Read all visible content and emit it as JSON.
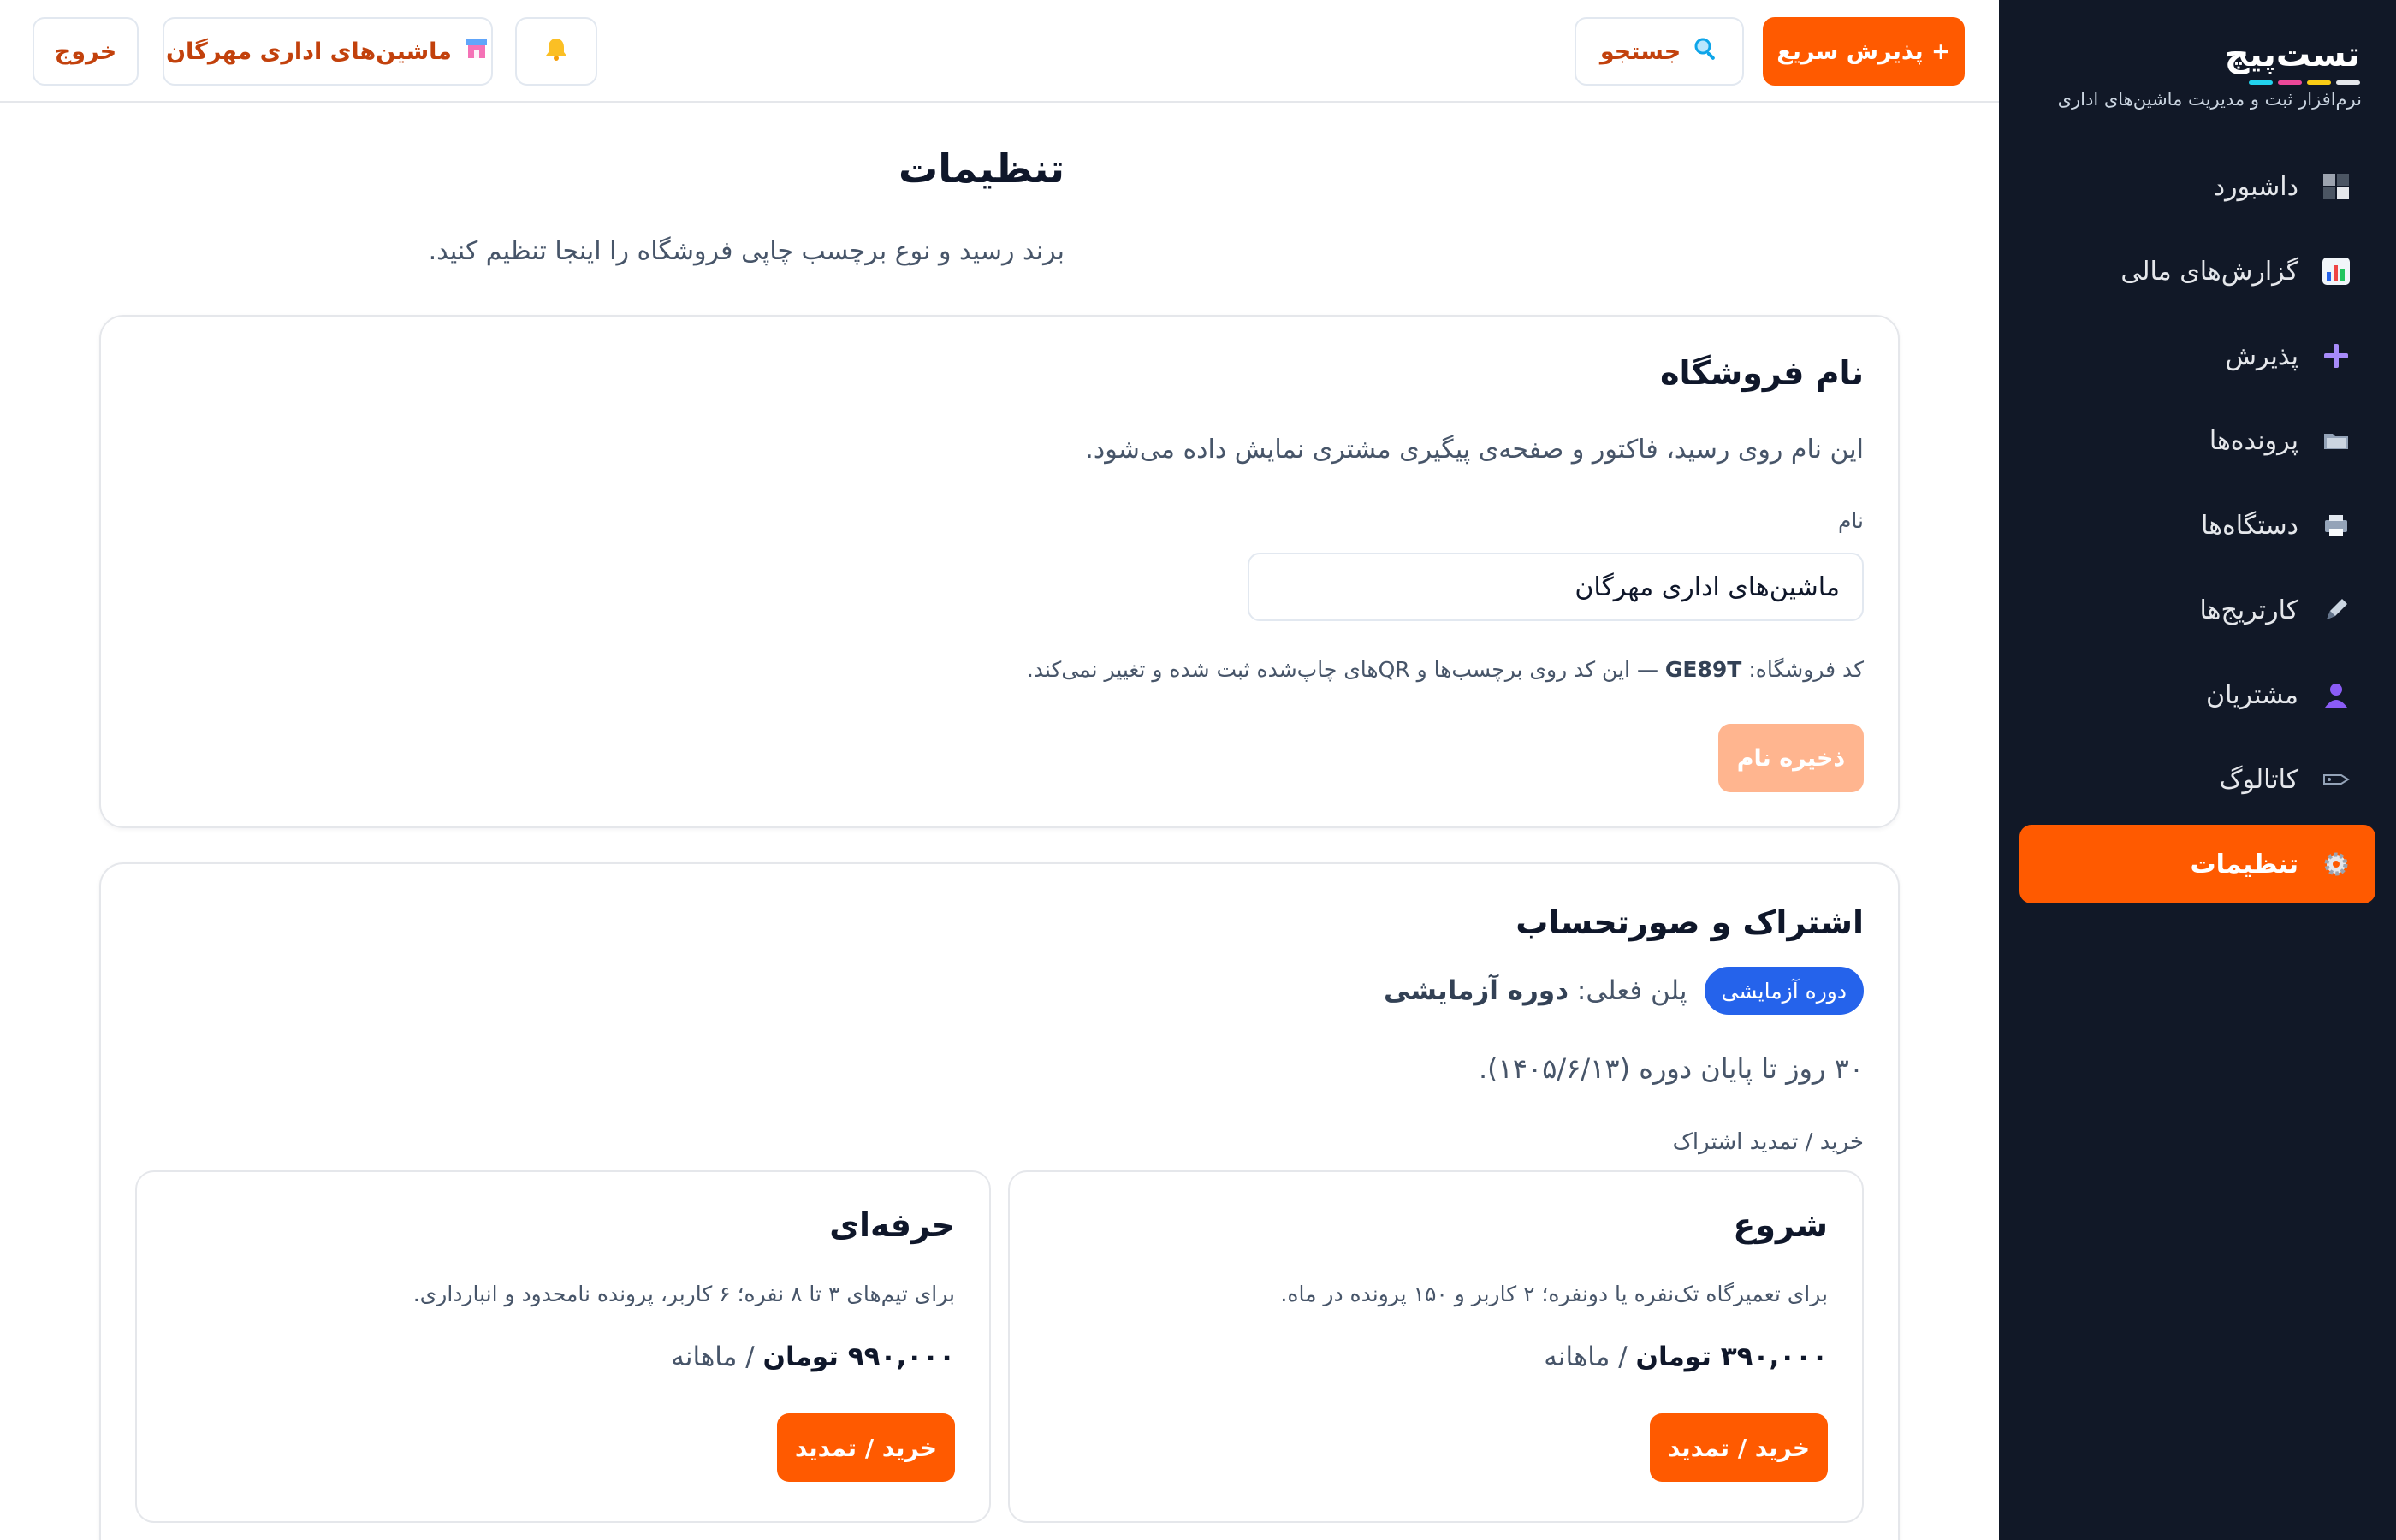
{
  "brand": {
    "name": "تست‌پیچ",
    "tagline": "نرم‌افزار ثبت و مدیریت ماشین‌های اداری",
    "bar_colors": [
      "#22d3ee",
      "#ec4899",
      "#facc15",
      "#e5e7eb"
    ]
  },
  "sidebar": {
    "items": [
      {
        "label": "داشبورد",
        "icon": "dashboard-icon",
        "glyph": "▚"
      },
      {
        "label": "گزارش‌های مالی",
        "icon": "bar-chart-icon",
        "glyph": "📊"
      },
      {
        "label": "پذیرش",
        "icon": "plus-icon",
        "glyph": "✚"
      },
      {
        "label": "پرونده‌ها",
        "icon": "folders-icon",
        "glyph": "🗂"
      },
      {
        "label": "دستگاه‌ها",
        "icon": "printer-icon",
        "glyph": "🖨"
      },
      {
        "label": "کارتریج‌ها",
        "icon": "pen-icon",
        "glyph": "✎"
      },
      {
        "label": "مشتریان",
        "icon": "user-icon",
        "glyph": "👤"
      },
      {
        "label": "کاتالوگ",
        "icon": "tag-icon",
        "glyph": "🏷"
      },
      {
        "label": "تنظیمات",
        "icon": "gear-icon",
        "glyph": "⚙"
      }
    ],
    "active_index": 8
  },
  "topbar": {
    "quick_intake": "+ پذیرش سریع",
    "search": "جستجو",
    "store": "ماشین‌های اداری مهرگان",
    "logout": "خروج",
    "bell_glyph": "🔔",
    "search_glyph": "🔍",
    "store_glyph": "🏪"
  },
  "page": {
    "title": "تنظیمات",
    "subtitle": "برند رسید و نوع برچسب چاپی فروشگاه را اینجا تنظیم کنید."
  },
  "store_card": {
    "title": "نام فروشگاه",
    "description": "این نام روی رسید، فاکتور و صفحه‌ی پیگیری مشتری نمایش داده می‌شود.",
    "name_label": "نام",
    "name_value": "ماشین‌های اداری مهرگان",
    "code_label": "کد فروشگاه:",
    "code": "GE89T",
    "code_note": "— این کد روی برچسب‌ها و QRهای چاپ‌شده ثبت شده و تغییر نمی‌کند.",
    "save_button": "ذخیره نام"
  },
  "subscription_card": {
    "title": "اشتراک و صورتحساب",
    "badge": "دوره آزمایشی",
    "current_plan_label": "پلن فعلی:",
    "current_plan": "دوره آزمایشی",
    "days_left": "۳۰ روز تا پایان دوره (۱۴۰۵/۶/۱۳).",
    "buy_section_label": "خرید / تمدید اشتراک",
    "plans": [
      {
        "name": "شروع",
        "description": "برای تعمیرگاه تک‌نفره یا دونفره؛ ۲ کاربر و ۱۵۰ پرونده در ماه.",
        "price": "۳۹۰,۰۰۰ تومان",
        "period": "/ ماهانه",
        "button": "خرید / تمدید"
      },
      {
        "name": "حرفه‌ای",
        "description": "برای تیم‌های ۳ تا ۸ نفره؛ ۶ کاربر، پرونده نامحدود و انبارداری.",
        "price": "۹۹۰,۰۰۰ تومان",
        "period": "/ ماهانه",
        "button": "خرید / تمدید"
      }
    ]
  },
  "colors": {
    "accent": "#ff5a00",
    "sidebar_bg": "#111827",
    "badge_blue": "#2563eb"
  }
}
